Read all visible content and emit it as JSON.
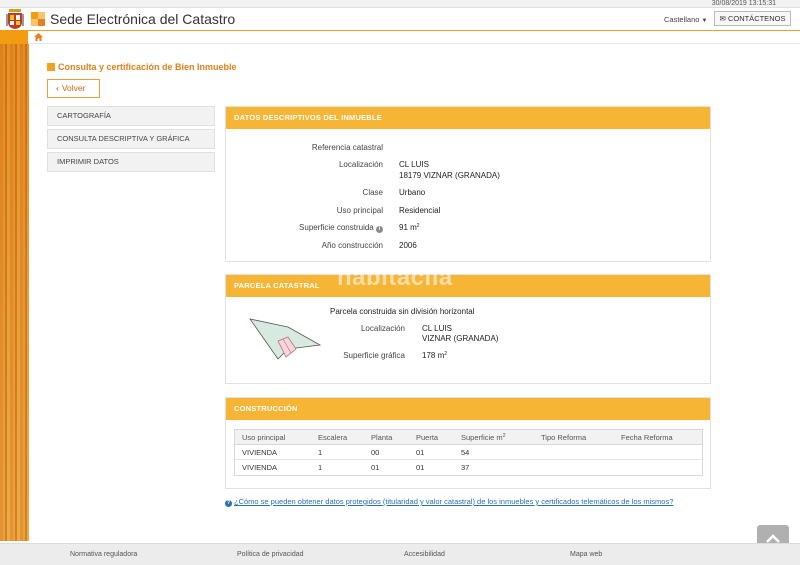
{
  "topbar": {
    "datetime": "30/08/2019  13:15:31"
  },
  "header": {
    "title": "Sede Electrónica del Catastro",
    "language": "Castellano",
    "contact_label": "CONTÁCTENOS"
  },
  "page": {
    "title": "Consulta y certificación de Bien Inmueble",
    "back_label": "Volver"
  },
  "sidebar": {
    "items": [
      {
        "label": "CARTOGRAFÍA"
      },
      {
        "label": "CONSULTA DESCRIPTIVA Y GRÁFICA"
      },
      {
        "label": "IMPRIMIR DATOS"
      }
    ]
  },
  "descriptive": {
    "header": "DATOS DESCRIPTIVOS DEL INMUEBLE",
    "fields": [
      {
        "label": "Referencia catastral",
        "value": ""
      },
      {
        "label": "Localización",
        "value": "CL LUIS",
        "value2": "18179 VIZNAR (GRANADA)"
      },
      {
        "label": "Clase",
        "value": "Urbano"
      },
      {
        "label": "Uso principal",
        "value": "Residencial"
      },
      {
        "label": "Superficie construida",
        "value": "91 m",
        "unit_sup": "2"
      },
      {
        "label": "Año construcción",
        "value": "2006"
      }
    ]
  },
  "parcela": {
    "header": "PARCELA CATASTRAL",
    "subtitle": "Parcela construida sin división horizontal",
    "loc_label": "Localización",
    "loc_value": "CL LUIS",
    "loc_value2": "VIZNAR (GRANADA)",
    "area_label": "Superficie gráfica",
    "area_value": "178 m",
    "area_sup": "2"
  },
  "construccion": {
    "header": "CONSTRUCCIÓN",
    "columns": [
      "Uso principal",
      "Escalera",
      "Planta",
      "Puerta",
      "Superficie m",
      "Tipo Reforma",
      "Fecha Reforma"
    ],
    "col_sup": "2",
    "rows": [
      [
        "VIVIENDA",
        "1",
        "00",
        "01",
        "54",
        "",
        ""
      ],
      [
        "VIVIENDA",
        "1",
        "01",
        "01",
        "37",
        "",
        ""
      ]
    ]
  },
  "help_link": "¿Cómo se pueden obtener datos protegidos (titularidad y valor catastral) de los inmuebles y certificados telemáticos de los mismos?",
  "watermark": "habitaclia",
  "footer": {
    "links": [
      "Normativa reguladora",
      "Política de privacidad",
      "Accesibilidad",
      "Mapa web"
    ]
  },
  "colors": {
    "accent": "#f7b535",
    "title": "#e0801a",
    "link": "#2a6fb0"
  }
}
